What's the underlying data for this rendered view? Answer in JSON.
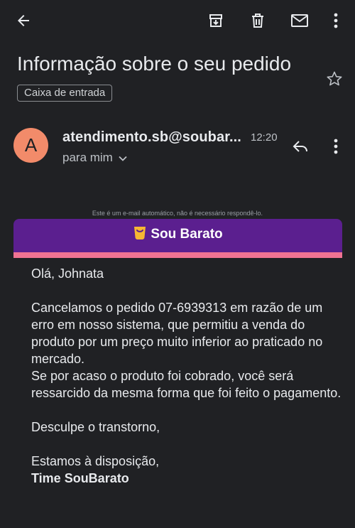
{
  "toolbar": {
    "back_icon": "arrow-left-icon",
    "archive_icon": "archive-icon",
    "delete_icon": "trash-icon",
    "mark_unread_icon": "mail-icon",
    "more_icon": "more-vert-icon"
  },
  "email": {
    "subject": "Informação sobre o seu pedido",
    "label": "Caixa de entrada",
    "star_icon": "star-outline-icon",
    "sender": {
      "avatar_letter": "A",
      "name": "atendimento.sb@soubar...",
      "time": "12:20",
      "recipient": "para mim"
    },
    "notice": "Este é um e-mail automático, não é necessário respondê-lo.",
    "brand": {
      "name": "Sou Barato",
      "banner_color": "#5b1f8f",
      "stripe_color": "#f07393",
      "logo_color": "#f7b733"
    },
    "body": {
      "greeting": "Olá, Johnata",
      "paragraph1": "Cancelamos o pedido 07-6939313 em razão de um erro em nosso sistema, que permitiu a venda do produto por um preço muito inferior ao praticado no mercado.",
      "paragraph2": "Se por acaso o produto foi cobrado, você será ressarcido da mesma forma que foi feito o pagamento.",
      "apology": "Desculpe o transtorno,",
      "closing": "Estamos à disposição,",
      "signature": "Time SouBarato"
    }
  },
  "colors": {
    "background": "#202124",
    "text": "#e8eaed",
    "secondary_text": "#bdc1c6",
    "avatar": "#f28b6a"
  }
}
